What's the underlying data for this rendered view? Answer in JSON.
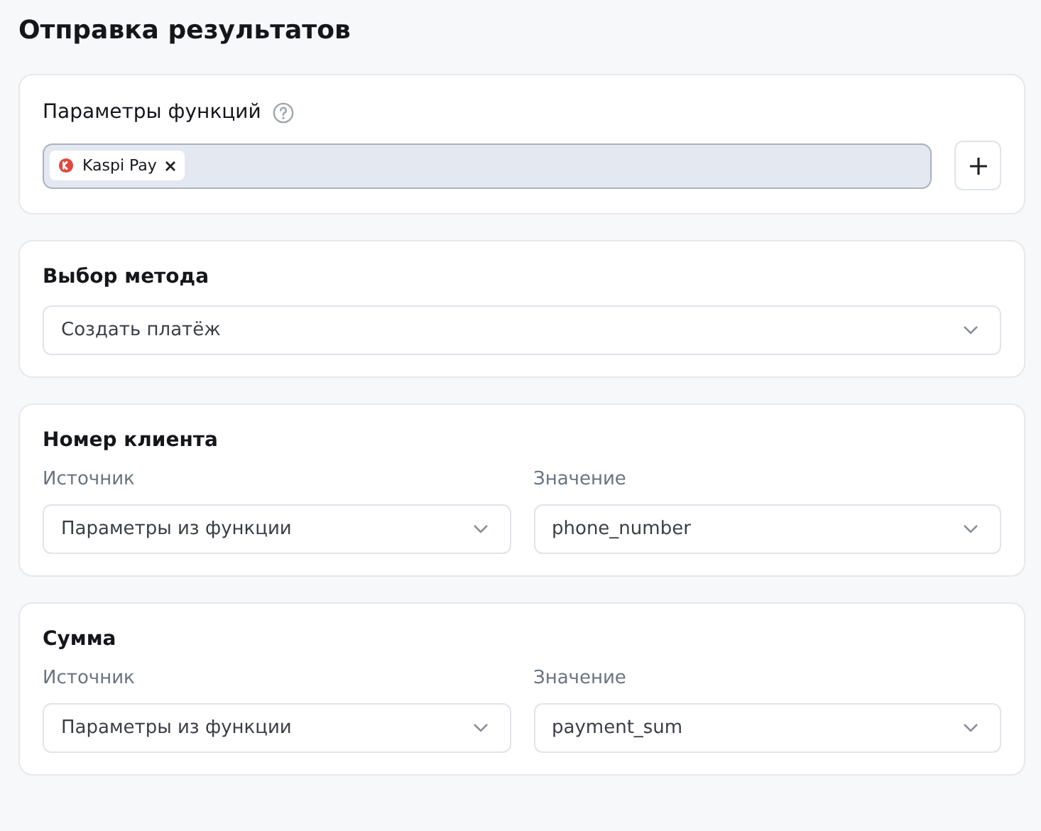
{
  "page_title": "Отправка результатов",
  "sections": [
    {
      "kind": "tags",
      "title": "Параметры функций",
      "help": true,
      "tags": [
        {
          "label": "Kaspi Pay",
          "removable": true
        }
      ]
    },
    {
      "kind": "select",
      "title": "Выбор метода",
      "value": "Создать платёж"
    },
    {
      "kind": "pair",
      "title": "Номер клиента",
      "fields": [
        {
          "label": "Источник",
          "value": "Параметры из функции"
        },
        {
          "label": "Значение",
          "value": "phone_number"
        }
      ]
    },
    {
      "kind": "pair",
      "title": "Сумма",
      "fields": [
        {
          "label": "Источник",
          "value": "Параметры из функции"
        },
        {
          "label": "Значение",
          "value": "payment_sum"
        }
      ]
    }
  ]
}
